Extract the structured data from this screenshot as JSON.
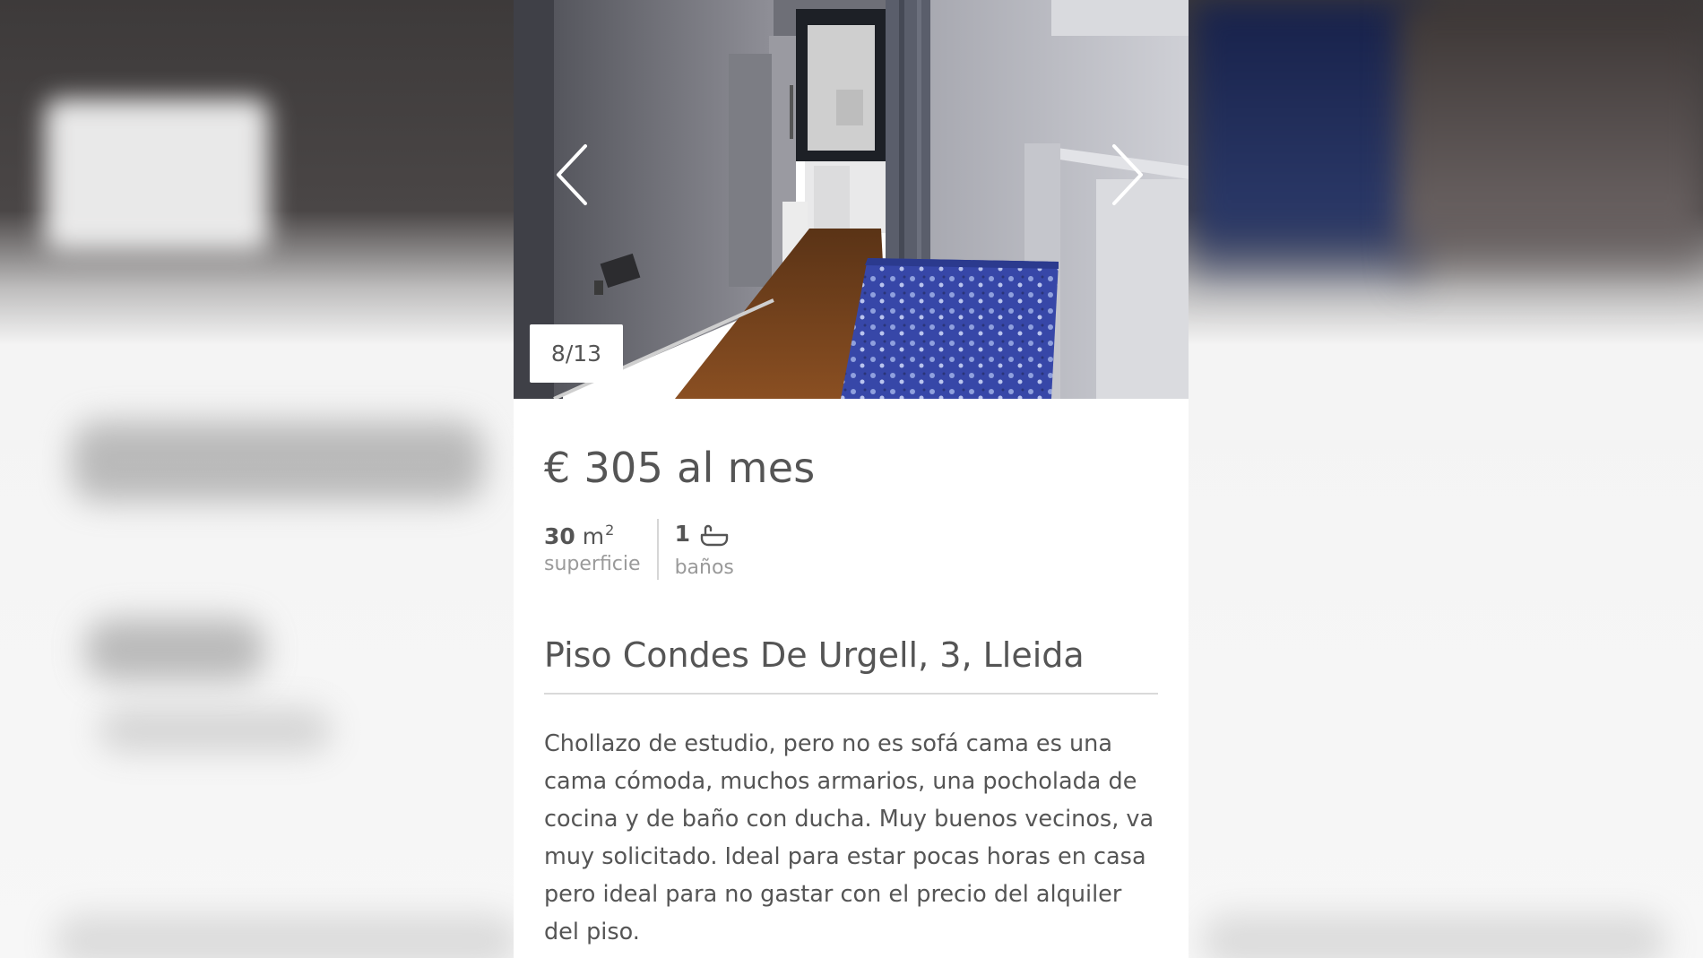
{
  "gallery": {
    "counter": "8/13",
    "prev_icon": "chevron-left-icon",
    "next_icon": "chevron-right-icon",
    "current_index": 8,
    "total_images": 13
  },
  "listing": {
    "price": "€ 305 al mes",
    "features": {
      "surface_value": "30",
      "surface_unit": "m",
      "surface_unit_exp": "2",
      "surface_label": "superficie",
      "baths_value": "1",
      "baths_icon": "bathtub-icon",
      "baths_label": "baños"
    },
    "address": "Piso Condes De Urgell, 3, Lleida",
    "description": "Chollazo de estudio, pero no es sofá cama es una cama cómoda, muchos armarios, una pocholada de cocina y de baño con ducha. Muy buenos vecinos, va muy solicitado. Ideal para estar pocas horas en casa pero ideal para no gastar con el precio del alquiler del piso."
  },
  "colors": {
    "text": "#555555",
    "muted": "#9a9a9a",
    "card_bg": "#ffffff"
  }
}
